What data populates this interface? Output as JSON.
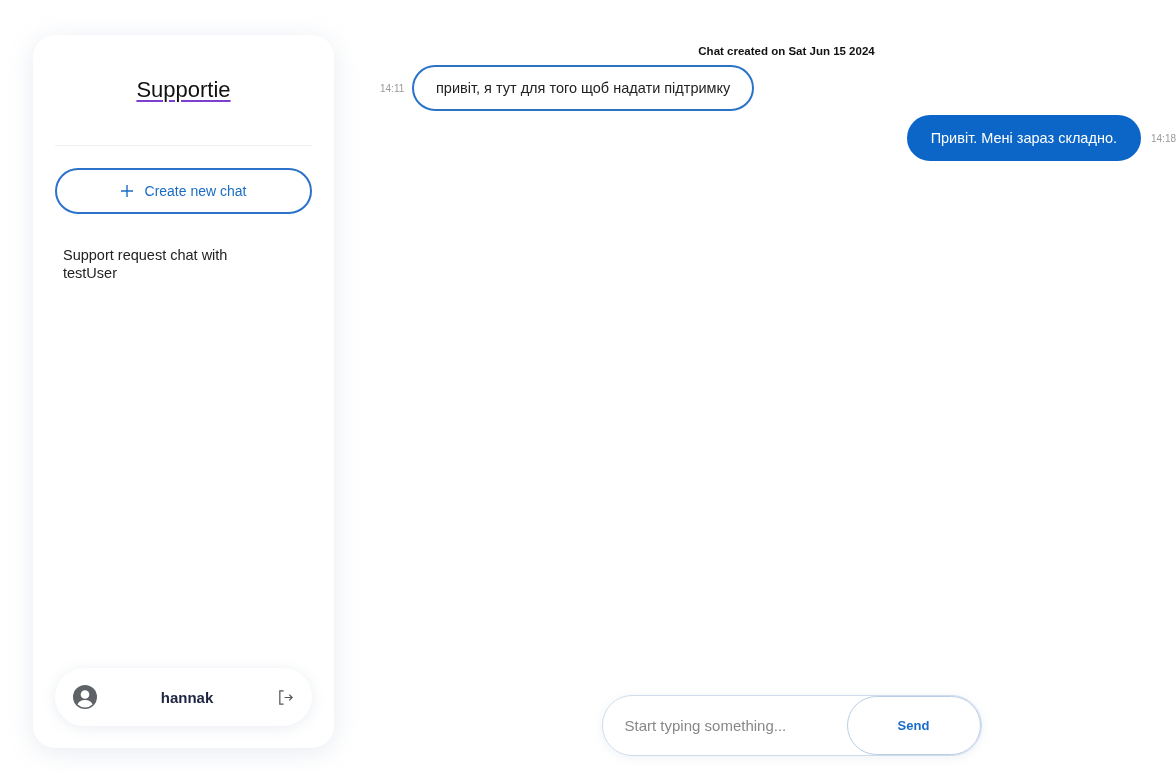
{
  "sidebar": {
    "logo": "Supportie",
    "create_button": "Create new chat",
    "chats": [
      {
        "title": "Support request chat with testUser"
      }
    ],
    "user": {
      "name": "hannak"
    }
  },
  "chat": {
    "created": "Chat created on Sat Jun 15 2024",
    "messages": [
      {
        "kind": "received",
        "text": "привіт, я тут для того щоб надати підтримку",
        "time": "14:11"
      },
      {
        "kind": "sent",
        "text": "Привіт. Мені зараз складно.",
        "time": "14:18"
      }
    ]
  },
  "composer": {
    "placeholder": "Start typing something...",
    "send": "Send"
  }
}
